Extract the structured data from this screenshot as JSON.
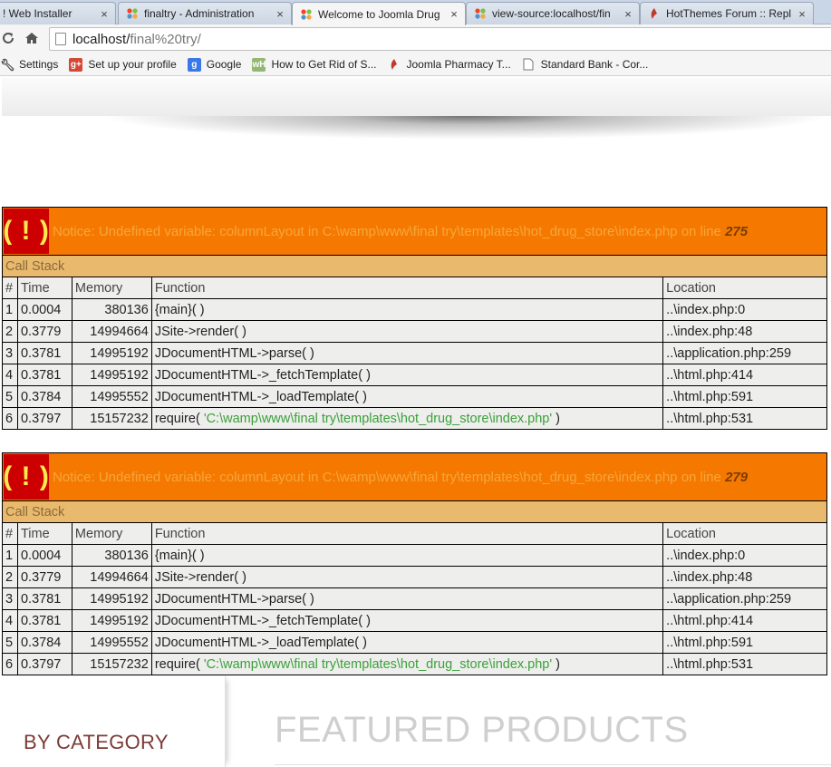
{
  "browser": {
    "tabs": [
      {
        "title": "! Web Installer",
        "icon": "joomla-icon",
        "active": false
      },
      {
        "title": "finaltry - Administration",
        "icon": "joomla-icon",
        "active": false
      },
      {
        "title": "Welcome to Joomla Drug",
        "icon": "joomla-icon",
        "active": true
      },
      {
        "title": "view-source:localhost/fin",
        "icon": "joomla-icon",
        "active": false
      },
      {
        "title": "HotThemes Forum :: Repl",
        "icon": "hotthemes-icon",
        "active": false
      }
    ],
    "close_glyph": "×",
    "url_host": "localhost/",
    "url_path": "final%20try/",
    "bookmarks": [
      {
        "label": "Settings",
        "icon": "wrench-icon"
      },
      {
        "label": "Set up your profile",
        "icon": "google-plus-icon"
      },
      {
        "label": "Google",
        "icon": "google-icon"
      },
      {
        "label": "How to Get Rid of S...",
        "icon": "wikihow-icon"
      },
      {
        "label": "Joomla Pharmacy T...",
        "icon": "hotthemes-icon"
      },
      {
        "label": "Standard Bank - Cor...",
        "icon": "page-icon"
      }
    ]
  },
  "errors": [
    {
      "warn_symbol": "( ! )",
      "message": "Notice: Undefined variable: columnLayout in C:\\wamp\\www\\final try\\templates\\hot_drug_store\\index.php on line ",
      "line": "275",
      "call_stack_label": "Call Stack",
      "headers": [
        "#",
        "Time",
        "Memory",
        "Function",
        "Location"
      ],
      "rows": [
        {
          "n": "1",
          "time": "0.0004",
          "memory": "380136",
          "function": "{main}( )",
          "location": "..\\index.php:0"
        },
        {
          "n": "2",
          "time": "0.3779",
          "memory": "14994664",
          "function": "JSite->render( )",
          "location": "..\\index.php:48"
        },
        {
          "n": "3",
          "time": "0.3781",
          "memory": "14995192",
          "function": "JDocumentHTML->parse( )",
          "location": "..\\application.php:259"
        },
        {
          "n": "4",
          "time": "0.3781",
          "memory": "14995192",
          "function": "JDocumentHTML->_fetchTemplate( )",
          "location": "..\\html.php:414"
        },
        {
          "n": "5",
          "time": "0.3784",
          "memory": "14995552",
          "function": "JDocumentHTML->_loadTemplate( )",
          "location": "..\\html.php:591"
        },
        {
          "n": "6",
          "time": "0.3797",
          "memory": "15157232",
          "function": "require( ",
          "function_arg": "'C:\\wamp\\www\\final try\\templates\\hot_drug_store\\index.php'",
          "function_end": " )",
          "location": "..\\html.php:531"
        }
      ]
    },
    {
      "warn_symbol": "( ! )",
      "message": "Notice: Undefined variable: columnLayout in C:\\wamp\\www\\final try\\templates\\hot_drug_store\\index.php on line ",
      "line": "279",
      "call_stack_label": "Call Stack",
      "headers": [
        "#",
        "Time",
        "Memory",
        "Function",
        "Location"
      ],
      "rows": [
        {
          "n": "1",
          "time": "0.0004",
          "memory": "380136",
          "function": "{main}( )",
          "location": "..\\index.php:0"
        },
        {
          "n": "2",
          "time": "0.3779",
          "memory": "14994664",
          "function": "JSite->render( )",
          "location": "..\\index.php:48"
        },
        {
          "n": "3",
          "time": "0.3781",
          "memory": "14995192",
          "function": "JDocumentHTML->parse( )",
          "location": "..\\application.php:259"
        },
        {
          "n": "4",
          "time": "0.3781",
          "memory": "14995192",
          "function": "JDocumentHTML->_fetchTemplate( )",
          "location": "..\\html.php:414"
        },
        {
          "n": "5",
          "time": "0.3784",
          "memory": "14995552",
          "function": "JDocumentHTML->_loadTemplate( )",
          "location": "..\\html.php:591"
        },
        {
          "n": "6",
          "time": "0.3797",
          "memory": "15157232",
          "function": "require( ",
          "function_arg": "'C:\\wamp\\www\\final try\\templates\\hot_drug_store\\index.php'",
          "function_end": " )",
          "location": "..\\html.php:531"
        }
      ]
    }
  ],
  "page": {
    "category_title": "BY CATEGORY",
    "featured_title": "FEATURED PRODUCTS"
  }
}
